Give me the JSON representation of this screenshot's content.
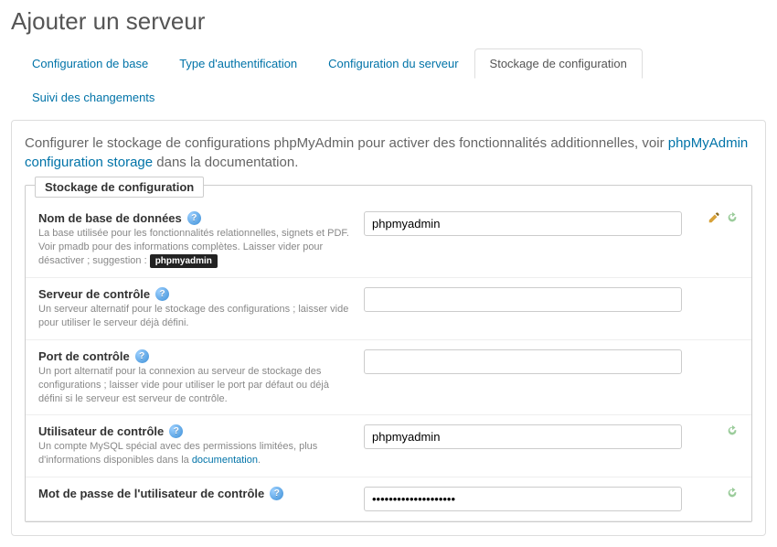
{
  "page_title": "Ajouter un serveur",
  "tabs": [
    {
      "label": "Configuration de base",
      "active": false
    },
    {
      "label": "Type d'authentification",
      "active": false
    },
    {
      "label": "Configuration du serveur",
      "active": false
    },
    {
      "label": "Stockage de configuration",
      "active": true
    },
    {
      "label": "Suivi des changements",
      "active": false
    }
  ],
  "intro": {
    "text_before": "Configurer le stockage de configurations phpMyAdmin pour activer des fonctionnalités additionnelles, voir ",
    "link_text": "phpMyAdmin configuration storage",
    "text_after": " dans la documentation."
  },
  "fieldset_legend": "Stockage de configuration",
  "fields": {
    "pmadb": {
      "label": "Nom de base de données",
      "desc": "La base utilisée pour les fonctionnalités relationnelles, signets et PDF. Voir pmadb pour des informations complètes. Laisser vider pour désactiver ; suggestion : ",
      "suggestion": "phpmyadmin",
      "value": "phpmyadmin"
    },
    "controlhost": {
      "label": "Serveur de contrôle",
      "desc": "Un serveur alternatif pour le stockage des configurations ; laisser vide pour utiliser le serveur déjà défini.",
      "value": ""
    },
    "controlport": {
      "label": "Port de contrôle",
      "desc": "Un port alternatif pour la connexion au serveur de stockage des configurations ; laisser vide pour utiliser le port par défaut ou déjà défini si le serveur est serveur de contrôle.",
      "value": ""
    },
    "controluser": {
      "label": "Utilisateur de contrôle",
      "desc_before": "Un compte MySQL spécial avec des permissions limitées, plus d'informations disponibles dans la ",
      "desc_link": "documentation",
      "desc_after": ".",
      "value": "phpmyadmin"
    },
    "controlpass": {
      "label": "Mot de passe de l'utilisateur de contrôle",
      "value": "••••••••••••••••••••"
    }
  }
}
